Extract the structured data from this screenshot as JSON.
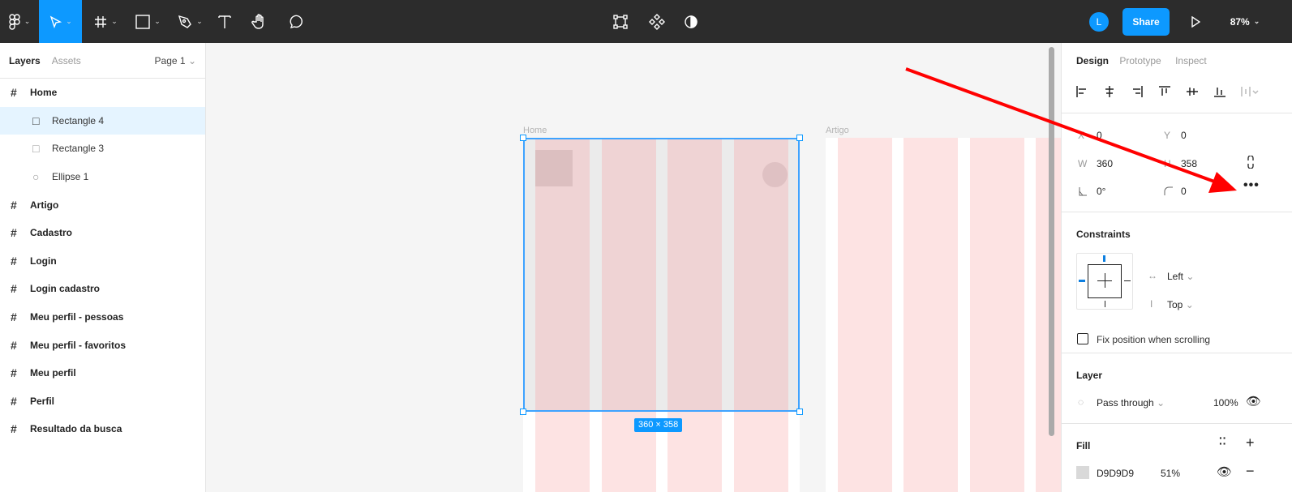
{
  "toolbar": {
    "tools": [
      "figma-menu",
      "move",
      "frame",
      "rectangle",
      "pen",
      "text",
      "hand",
      "comment"
    ],
    "avatar_initial": "L",
    "share_label": "Share",
    "zoom_label": "87%",
    "accent": "#0d99ff"
  },
  "left_panel": {
    "tabs": [
      "Layers",
      "Assets"
    ],
    "page": "Page 1",
    "layers": [
      {
        "label": "Home",
        "type": "frame"
      },
      {
        "label": "Rectangle 4",
        "type": "rect",
        "selected": true
      },
      {
        "label": "Rectangle 3",
        "type": "rect"
      },
      {
        "label": "Ellipse 1",
        "type": "ellipse"
      },
      {
        "label": "Artigo",
        "type": "frame"
      },
      {
        "label": "Cadastro",
        "type": "frame"
      },
      {
        "label": "Login",
        "type": "frame"
      },
      {
        "label": "Login cadastro",
        "type": "frame"
      },
      {
        "label": "Meu perfil - pessoas",
        "type": "frame"
      },
      {
        "label": "Meu perfil - favoritos",
        "type": "frame"
      },
      {
        "label": "Meu perfil",
        "type": "frame"
      },
      {
        "label": "Perfil",
        "type": "frame"
      },
      {
        "label": "Resultado da busca",
        "type": "frame"
      }
    ]
  },
  "canvas": {
    "frames": [
      "Home",
      "Artigo"
    ],
    "size_badge": "360 × 358"
  },
  "right_panel": {
    "tabs": [
      "Design",
      "Prototype",
      "Inspect"
    ],
    "position": {
      "x_label": "X",
      "x": "0",
      "y_label": "Y",
      "y": "0",
      "w_label": "W",
      "w": "360",
      "h_label": "H",
      "h": "358",
      "rotation": "0°",
      "radius": "0"
    },
    "constraints": {
      "title": "Constraints",
      "horizontal": "Left",
      "vertical": "Top",
      "fix_label": "Fix position when scrolling"
    },
    "layer": {
      "title": "Layer",
      "blend": "Pass through",
      "opacity": "100%"
    },
    "fill": {
      "title": "Fill",
      "hex": "D9D9D9",
      "opacity": "51%"
    }
  }
}
